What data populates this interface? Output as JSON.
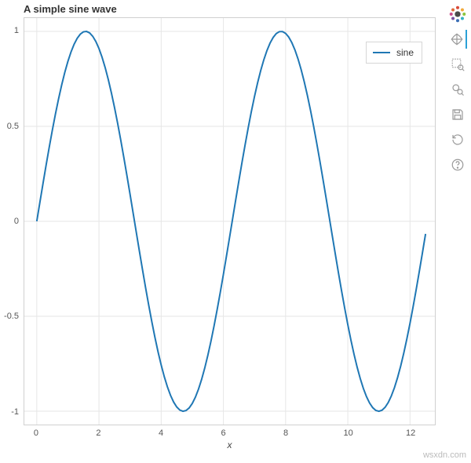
{
  "chart_data": {
    "type": "line",
    "title": "A simple sine wave",
    "xlabel": "x",
    "ylabel": "",
    "xlim": [
      -0.4,
      12.8
    ],
    "ylim": [
      -1.07,
      1.07
    ],
    "x_ticks": [
      0,
      2,
      4,
      6,
      8,
      10,
      12
    ],
    "y_ticks": [
      -1,
      -0.5,
      0,
      0.5,
      1
    ],
    "series": [
      {
        "name": "sine",
        "color": "#1f77b4",
        "x": [
          0,
          0.1,
          0.2,
          0.3,
          0.4,
          0.5,
          0.6,
          0.7,
          0.8,
          0.9,
          1.0,
          1.1,
          1.2,
          1.3,
          1.4,
          1.5,
          1.6,
          1.7,
          1.8,
          1.9,
          2.0,
          2.1,
          2.2,
          2.3,
          2.4,
          2.5,
          2.6,
          2.7,
          2.8,
          2.9,
          3.0,
          3.1,
          3.2,
          3.3,
          3.4,
          3.5,
          3.6,
          3.7,
          3.8,
          3.9,
          4.0,
          4.1,
          4.2,
          4.3,
          4.4,
          4.5,
          4.6,
          4.7,
          4.8,
          4.9,
          5.0,
          5.1,
          5.2,
          5.3,
          5.4,
          5.5,
          5.6,
          5.7,
          5.8,
          5.9,
          6.0,
          6.1,
          6.2,
          6.3,
          6.4,
          6.5,
          6.6,
          6.7,
          6.8,
          6.9,
          7.0,
          7.1,
          7.2,
          7.3,
          7.4,
          7.5,
          7.6,
          7.7,
          7.8,
          7.9,
          8.0,
          8.1,
          8.2,
          8.3,
          8.4,
          8.5,
          8.6,
          8.7,
          8.8,
          8.9,
          9.0,
          9.1,
          9.2,
          9.3,
          9.4,
          9.5,
          9.6,
          9.7,
          9.8,
          9.9,
          10.0,
          10.1,
          10.2,
          10.3,
          10.4,
          10.5,
          10.6,
          10.7,
          10.8,
          10.9,
          11.0,
          11.1,
          11.2,
          11.3,
          11.4,
          11.5,
          11.6,
          11.7,
          11.8,
          11.9,
          12.0,
          12.1,
          12.2,
          12.3,
          12.4,
          12.5
        ],
        "y": [
          0.0,
          0.0998,
          0.1987,
          0.2955,
          0.3894,
          0.4794,
          0.5646,
          0.6442,
          0.7174,
          0.7833,
          0.8415,
          0.8912,
          0.932,
          0.9636,
          0.9854,
          0.9975,
          0.9996,
          0.9917,
          0.9738,
          0.9463,
          0.9093,
          0.8632,
          0.8085,
          0.7457,
          0.6755,
          0.5985,
          0.5155,
          0.4274,
          0.335,
          0.2392,
          0.1411,
          0.0416,
          -0.0584,
          -0.1577,
          -0.2555,
          -0.3508,
          -0.4425,
          -0.5298,
          -0.6119,
          -0.6878,
          -0.7568,
          -0.8183,
          -0.8716,
          -0.9162,
          -0.9516,
          -0.9775,
          -0.9937,
          -0.9999,
          -0.9962,
          -0.9825,
          -0.9589,
          -0.9258,
          -0.8835,
          -0.8323,
          -0.7728,
          -0.7055,
          -0.6313,
          -0.5507,
          -0.4646,
          -0.3739,
          -0.2794,
          -0.1822,
          -0.0831,
          0.0168,
          0.1165,
          0.2151,
          0.3115,
          0.4048,
          0.4941,
          0.5784,
          0.657,
          0.729,
          0.7937,
          0.8504,
          0.8987,
          0.938,
          0.9679,
          0.9882,
          0.9985,
          0.9989,
          0.9894,
          0.9699,
          0.9407,
          0.9022,
          0.8546,
          0.7985,
          0.7344,
          0.663,
          0.5849,
          0.501,
          0.4121,
          0.3191,
          0.2229,
          0.1245,
          0.0248,
          -0.0752,
          -0.1743,
          -0.2718,
          -0.3665,
          -0.4575,
          -0.544,
          -0.6251,
          -0.6999,
          -0.7677,
          -0.8278,
          -0.8797,
          -0.9228,
          -0.9566,
          -0.9809,
          -0.9954,
          -0.9999,
          -0.9945,
          -0.9792,
          -0.954,
          -0.9193,
          -0.8755,
          -0.8228,
          -0.762,
          -0.6935,
          -0.6181,
          -0.5366,
          -0.4496,
          -0.3582,
          -0.2632,
          -0.1656,
          -0.0663
        ]
      }
    ]
  },
  "legend": {
    "position": "top_right",
    "items": [
      "sine"
    ]
  },
  "toolbar": {
    "logo": "bokeh",
    "tools": [
      {
        "id": "pan",
        "label": "Pan",
        "active": true
      },
      {
        "id": "box-zoom",
        "label": "Box Zoom",
        "active": false
      },
      {
        "id": "wheel-zoom",
        "label": "Wheel Zoom",
        "active": false
      },
      {
        "id": "save",
        "label": "Save",
        "active": false
      },
      {
        "id": "reset",
        "label": "Reset",
        "active": false
      },
      {
        "id": "help",
        "label": "Help",
        "active": false
      }
    ]
  },
  "watermark": "wsxdn.com"
}
